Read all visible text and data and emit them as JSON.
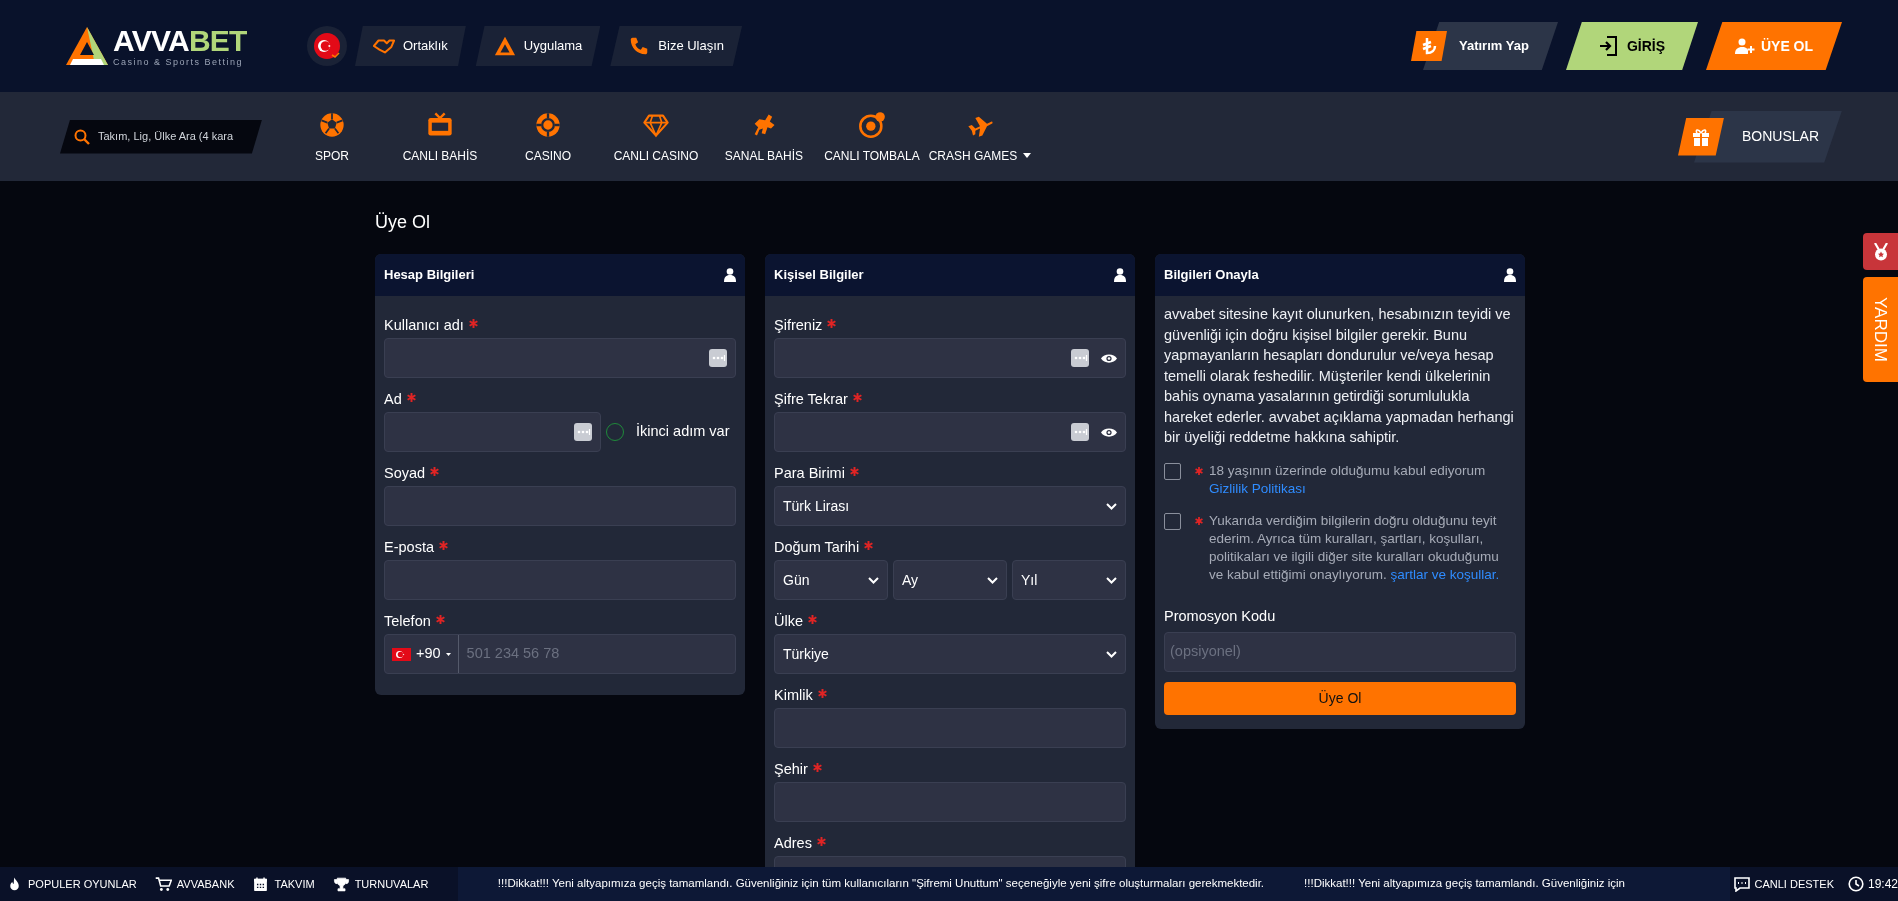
{
  "header": {
    "logo": {
      "text_1": "AVVA",
      "text_2": "BET",
      "tagline": "Casino & Sports Betting"
    },
    "top_links": [
      {
        "label": "Ortaklık",
        "kind": "handshake"
      },
      {
        "label": "Uygulama",
        "kind": "app"
      },
      {
        "label": "Bize Ulaşın",
        "kind": "phone"
      }
    ],
    "actions": [
      {
        "label": "Yatırım Yap",
        "kind": "deposit"
      },
      {
        "label": "GİRİŞ",
        "kind": "login"
      },
      {
        "label": "ÜYE OL",
        "kind": "register"
      }
    ]
  },
  "nav": {
    "search": {
      "placeholder": "Takım, Lig, Ülke Ara (4 kara"
    },
    "items": [
      {
        "label": "SPOR",
        "kind": "ball",
        "dropdown": false
      },
      {
        "label": "CANLI BAHİS",
        "kind": "tv",
        "dropdown": false
      },
      {
        "label": "CASINO",
        "kind": "chip",
        "dropdown": false
      },
      {
        "label": "CANLI CASINO",
        "kind": "diamond",
        "dropdown": false
      },
      {
        "label": "SANAL BAHİS",
        "kind": "horse",
        "dropdown": false
      },
      {
        "label": "CANLI TOMBALA",
        "kind": "bingo",
        "dropdown": false
      },
      {
        "label": "CRASH GAMES",
        "kind": "plane",
        "dropdown": true
      }
    ],
    "bonus": {
      "label": "BONUSLAR"
    }
  },
  "page_title": "Üye Ol",
  "cards": [
    {
      "title": "Hesap Bilgileri",
      "fields": [
        {
          "label": "Kullanıcı adı",
          "required": true,
          "kind": "text",
          "key_icon": true
        },
        {
          "label": "Ad",
          "required": true,
          "kind": "text_toggle",
          "key_icon": true,
          "toggle_label": "İkinci adım var",
          "toggle_on": false
        },
        {
          "label": "Soyad",
          "required": true,
          "kind": "text",
          "key_icon": false
        },
        {
          "label": "E-posta",
          "required": true,
          "kind": "text",
          "key_icon": false
        },
        {
          "label": "Telefon",
          "required": true,
          "kind": "phone",
          "code": "+90",
          "placeholder": "501 234 56 78"
        }
      ]
    },
    {
      "title": "Kişisel Bilgiler",
      "fields": [
        {
          "label": "Şifreniz",
          "required": true,
          "kind": "password",
          "key_icon": true
        },
        {
          "label": "Şifre Tekrar",
          "required": true,
          "kind": "password",
          "key_icon": true
        },
        {
          "label": "Para Birimi",
          "required": true,
          "kind": "select",
          "value": "Türk Lirası"
        },
        {
          "label": "Doğum Tarihi",
          "required": true,
          "kind": "date",
          "values": [
            "Gün",
            "Ay",
            "Yıl"
          ]
        },
        {
          "label": "Ülke",
          "required": true,
          "kind": "select",
          "value": "Türkiye"
        },
        {
          "label": "Kimlik",
          "required": true,
          "kind": "text",
          "key_icon": false
        },
        {
          "label": "Şehir",
          "required": true,
          "kind": "text",
          "key_icon": false
        },
        {
          "label": "Adres",
          "required": true,
          "kind": "text",
          "key_icon": false
        }
      ]
    }
  ],
  "confirm": {
    "title": "Bilgileri Onayla",
    "text": "avvabet sitesine kayıt olunurken, hesabınızın teyidi ve güvenliği için doğru kişisel bilgiler gerekir. Bunu yapmayanların hesapları dondurulur ve/veya hesap temelli olarak feshedilir. Müşteriler kendi ülkelerinin bahis oynama yasalarının getirdiği sorumlulukla hareket ederler. avvabet açıklama yapmadan herhangi bir üyeliği reddetme hakkına sahiptir.",
    "checkboxes": [
      {
        "text": "18 yaşının üzerinde olduğumu kabul ediyorum",
        "link": "Gizlilik Politikası",
        "checked": false,
        "required": true
      },
      {
        "text": "Yukarıda verdiğim bilgilerin doğru olduğunu teyit ederim. Ayrıca tüm kuralları, şartları, koşulları, politikaları ve ilgili diğer site kuralları okuduğumu ve kabul ettiğimi onaylıyorum.",
        "link": "şartlar ve koşullar.",
        "checked": false,
        "required": true
      }
    ],
    "promo": {
      "label": "Promosyon Kodu",
      "placeholder": "(opsiyonel)"
    },
    "submit": "Üye Ol"
  },
  "side_tabs": [
    {
      "kind": "badge"
    },
    {
      "kind": "help",
      "label": "YARDIM"
    }
  ],
  "bottom_bar": {
    "items": [
      {
        "label": "POPULER OYUNLAR",
        "kind": "fire"
      },
      {
        "label": "AVVABANK",
        "kind": "cart"
      },
      {
        "label": "TAKVIM",
        "kind": "calendar"
      },
      {
        "label": "TURNUVALAR",
        "kind": "trophy"
      }
    ],
    "ticker": [
      "!!!Dikkat!!! Yeni altyapımıza geçiş tamamlandı. Güvenliğiniz için tüm kullanıcıların \"Şifremi Unuttum\" seçeneğiyle yeni şifre oluşturmaları gerekmektedir.",
      "!!!Dikkat!!! Yeni altyapımıza geçiş tamamlandı. Güvenliğiniz için"
    ],
    "support": "CANLI DESTEK",
    "time": "19:42"
  }
}
